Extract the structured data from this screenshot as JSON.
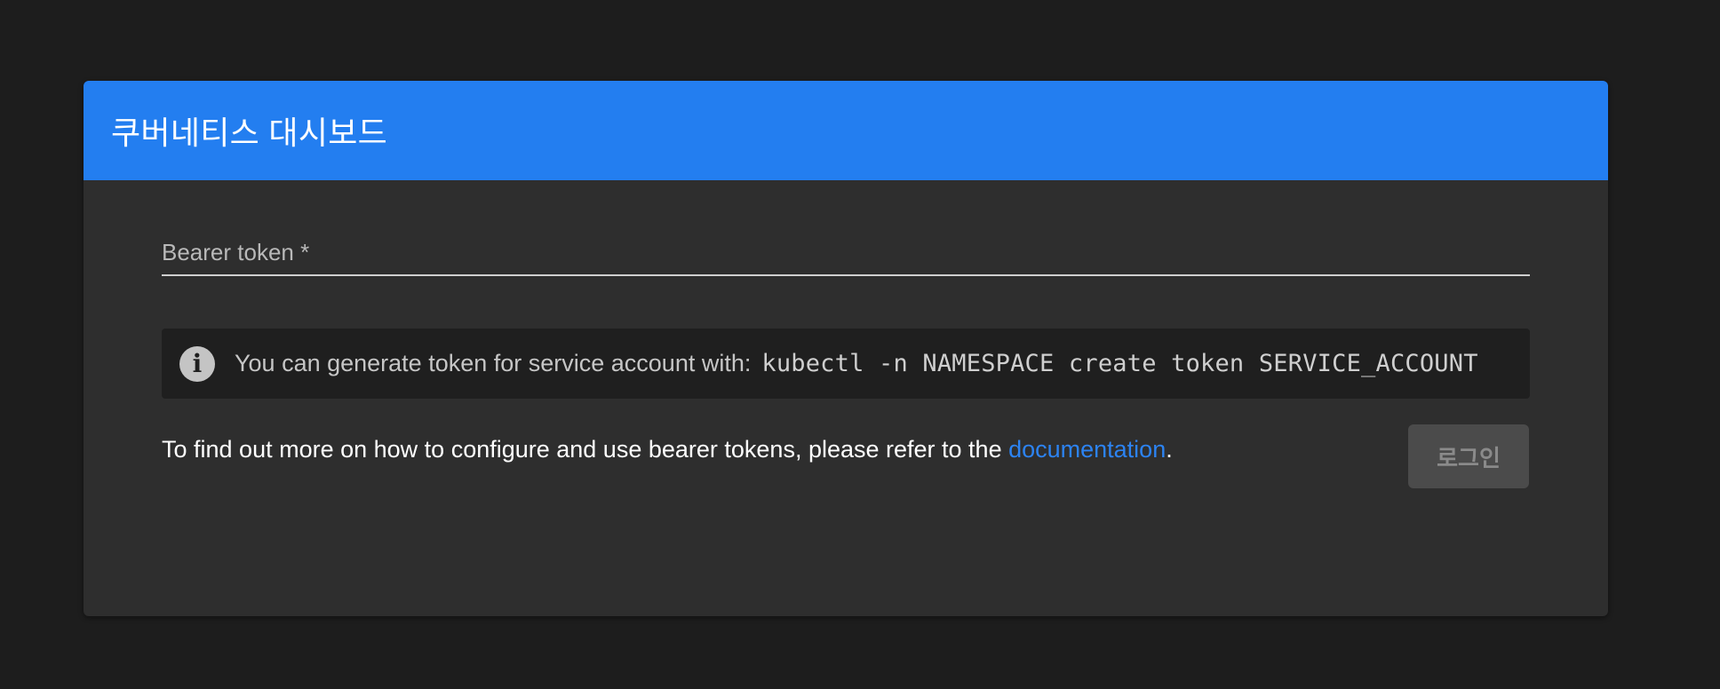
{
  "header": {
    "title": "쿠버네티스 대시보드"
  },
  "form": {
    "token_label": "Bearer token *",
    "token_value": ""
  },
  "info": {
    "text": "You can generate token for service account with:",
    "command": "kubectl -n NAMESPACE create token SERVICE_ACCOUNT",
    "icon": "info-icon"
  },
  "help": {
    "prefix": "To find out more on how to configure and use bearer tokens, please refer to the ",
    "link_text": "documentation",
    "suffix": "."
  },
  "actions": {
    "login_label": "로그인"
  },
  "colors": {
    "accent": "#237ef0",
    "link": "#2c83f2",
    "background": "#1d1d1d",
    "card": "#2e2e2e"
  }
}
